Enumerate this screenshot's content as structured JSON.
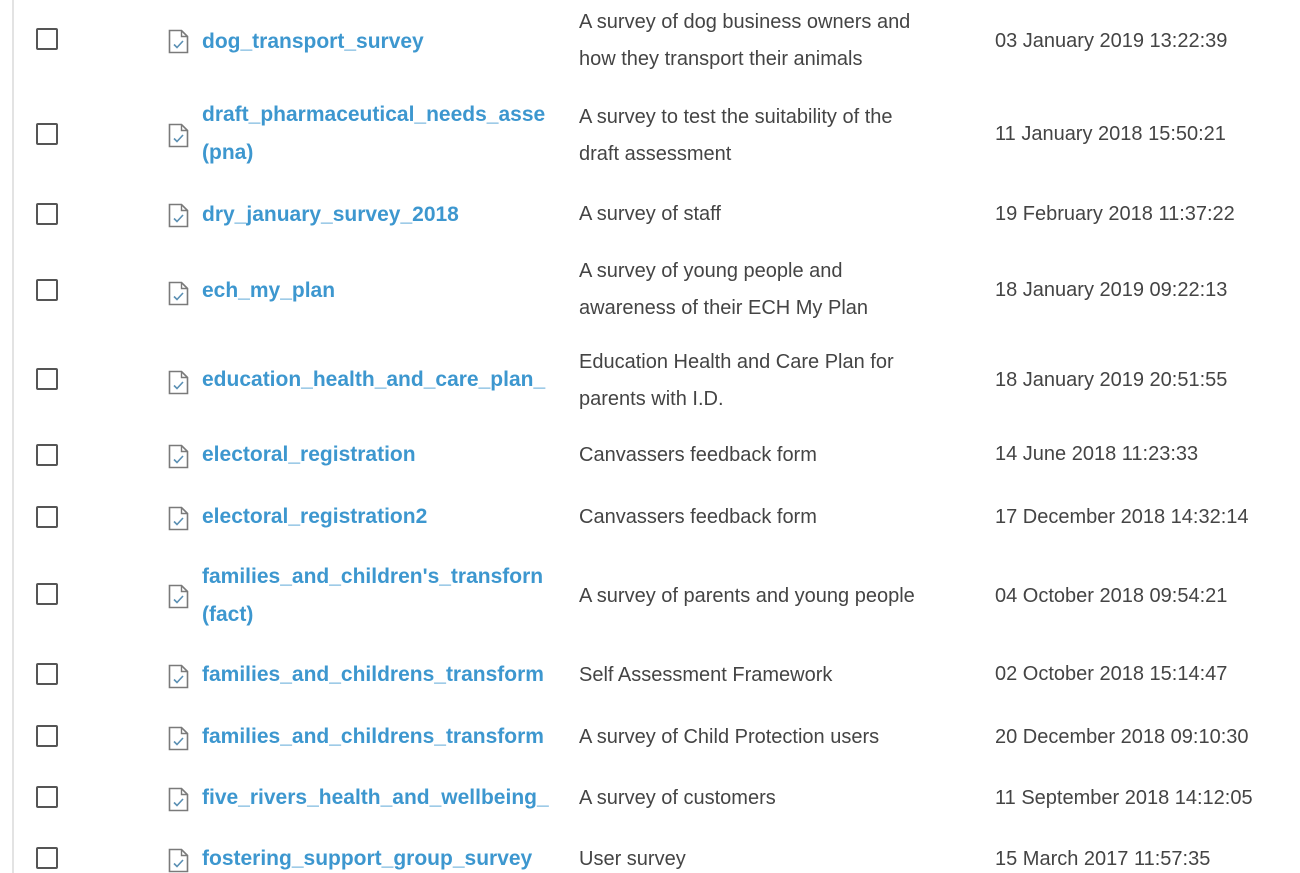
{
  "rows": [
    {
      "name_lines": [
        "dog_transport_survey"
      ],
      "desc_lines": [
        "A survey of dog business owners and",
        "how they transport their animals"
      ],
      "date": "03 January 2019 13:22:39"
    },
    {
      "name_lines": [
        "draft_pharmaceutical_needs_asse",
        "(pna)"
      ],
      "desc_lines": [
        "A survey to test the suitability of the",
        "draft assessment"
      ],
      "date": "11 January 2018 15:50:21"
    },
    {
      "name_lines": [
        "dry_january_survey_2018"
      ],
      "desc_lines": [
        "A survey of staff"
      ],
      "date": "19 February 2018 11:37:22"
    },
    {
      "name_lines": [
        "ech_my_plan"
      ],
      "desc_lines": [
        "A survey of young people and",
        "awareness of their ECH My Plan"
      ],
      "date": "18 January 2019 09:22:13"
    },
    {
      "name_lines": [
        "education_health_and_care_plan_"
      ],
      "desc_lines": [
        "Education Health and Care Plan for",
        "parents with I.D."
      ],
      "date": "18 January 2019 20:51:55"
    },
    {
      "name_lines": [
        "electoral_registration"
      ],
      "desc_lines": [
        "Canvassers feedback form"
      ],
      "date": "14 June 2018 11:23:33"
    },
    {
      "name_lines": [
        "electoral_registration2"
      ],
      "desc_lines": [
        "Canvassers feedback form"
      ],
      "date": "17 December 2018 14:32:14"
    },
    {
      "name_lines": [
        "families_and_children's_transforn",
        "(fact)"
      ],
      "desc_lines": [
        "A survey of parents and young people"
      ],
      "date": "04 October 2018 09:54:21"
    },
    {
      "name_lines": [
        "families_and_childrens_transform"
      ],
      "desc_lines": [
        "Self Assessment Framework"
      ],
      "date": "02 October 2018 15:14:47"
    },
    {
      "name_lines": [
        "families_and_childrens_transform"
      ],
      "desc_lines": [
        "A survey of Child Protection users"
      ],
      "date": "20 December 2018 09:10:30"
    },
    {
      "name_lines": [
        "five_rivers_health_and_wellbeing_"
      ],
      "desc_lines": [
        "A survey of customers"
      ],
      "date": "11 September 2018 14:12:05"
    },
    {
      "name_lines": [
        "fostering_support_group_survey"
      ],
      "desc_lines": [
        "User survey"
      ],
      "date": "15 March 2017 11:57:35"
    }
  ],
  "icons": {
    "checkbox": "checkbox-icon",
    "file": "document-icon"
  }
}
